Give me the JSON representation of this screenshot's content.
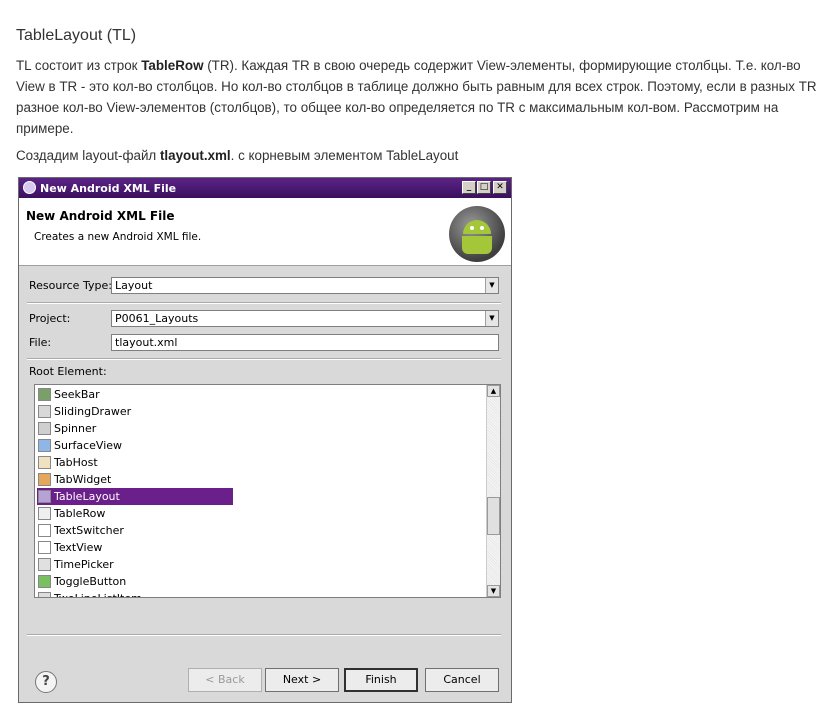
{
  "article": {
    "heading": "TableLayout (TL)",
    "para1": {
      "line1": [
        {
          "text": "TL состоит из строк ",
          "bold": false
        },
        {
          "text": "TableRow",
          "bold": true
        },
        {
          "text": " (TR). Каждая TR в свою очередь содержит View-элементы, формирующие столбцы. Т.е. кол-во",
          "bold": false
        }
      ],
      "line2": "View в TR - это кол-во столбцов. Но кол-во столбцов в таблице должно быть равным для всех строк. Поэтому, если в разных TR",
      "line3": "разное кол-во View-элементов (столбцов), то общее кол-во определяется по TR с максимальным кол-вом. Рассмотрим на",
      "line4": "примере."
    },
    "para2": {
      "before": "Создадим layout-файл ",
      "bold": "tlayout.xml",
      "after": ". с корневым элементом TableLayout"
    }
  },
  "dialog": {
    "window_title": "New Android XML File",
    "header_title": "New Android XML File",
    "header_subtitle": "Creates a new Android XML file.",
    "resource_type_label": "Resource Type:",
    "resource_type_value": "Layout",
    "project_label": "Project:",
    "project_value": "P0061_Layouts",
    "file_label": "File:",
    "file_value": "tlayout.xml",
    "root_element_label": "Root Element:",
    "root_elements": [
      {
        "label": "SeekBar",
        "icon": "seekbar-icon",
        "color": "#7aa06a"
      },
      {
        "label": "SlidingDrawer",
        "icon": "slidingdrawer-icon",
        "color": "#d8d8d8"
      },
      {
        "label": "Spinner",
        "icon": "spinner-icon",
        "color": "#cfcfcf"
      },
      {
        "label": "SurfaceView",
        "icon": "surfaceview-icon",
        "color": "#8fb6e8"
      },
      {
        "label": "TabHost",
        "icon": "tabhost-icon",
        "color": "#f0e2c0"
      },
      {
        "label": "TabWidget",
        "icon": "tabwidget-icon",
        "color": "#e5a85a"
      },
      {
        "label": "TableLayout",
        "icon": "tablelayout-icon",
        "color": "#b7a2d6"
      },
      {
        "label": "TableRow",
        "icon": "tablerow-icon",
        "color": "#efefef"
      },
      {
        "label": "TextSwitcher",
        "icon": "textswitcher-icon",
        "color": "#ffffff"
      },
      {
        "label": "TextView",
        "icon": "textview-icon",
        "color": "#ffffff"
      },
      {
        "label": "TimePicker",
        "icon": "timepicker-icon",
        "color": "#e0e0e0"
      },
      {
        "label": "ToggleButton",
        "icon": "togglebutton-icon",
        "color": "#79c060"
      },
      {
        "label": "TwoLineListItem",
        "icon": "twolinelistitem-icon",
        "color": "#dddddd"
      }
    ],
    "selected_root_element": "TableLayout",
    "buttons": {
      "back": "< Back",
      "next": "Next >",
      "finish": "Finish",
      "cancel": "Cancel"
    },
    "help_symbol": "?"
  }
}
